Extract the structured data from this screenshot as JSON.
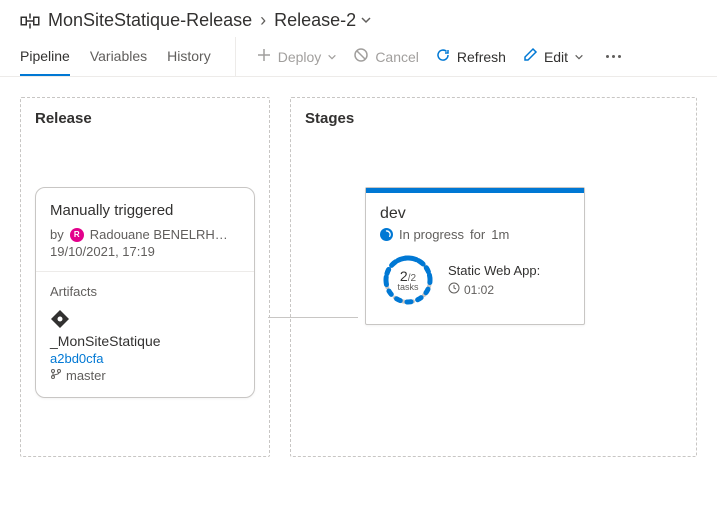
{
  "breadcrumb": {
    "parent": "MonSiteStatique-Release",
    "current": "Release-2"
  },
  "tabs": {
    "pipeline": "Pipeline",
    "variables": "Variables",
    "history": "History"
  },
  "toolbar": {
    "deploy": "Deploy",
    "cancel": "Cancel",
    "refresh": "Refresh",
    "edit": "Edit"
  },
  "release_panel": {
    "title": "Release",
    "trigger": "Manually triggered",
    "by_prefix": "by",
    "user": "Radouane BENELRH…",
    "timestamp": "19/10/2021, 17:19",
    "artifacts_label": "Artifacts",
    "artifact_alias": "_MonSiteStatique",
    "artifact_commit": "a2bd0cfa",
    "artifact_branch": "master"
  },
  "stages_panel": {
    "title": "Stages",
    "stage": {
      "name": "dev",
      "status_text": "In progress",
      "duration_prefix": "for",
      "duration": "1m",
      "tasks_done": "2",
      "tasks_total": "/2",
      "tasks_label": "tasks",
      "task_name": "Static Web App:",
      "task_duration": "01:02"
    }
  }
}
